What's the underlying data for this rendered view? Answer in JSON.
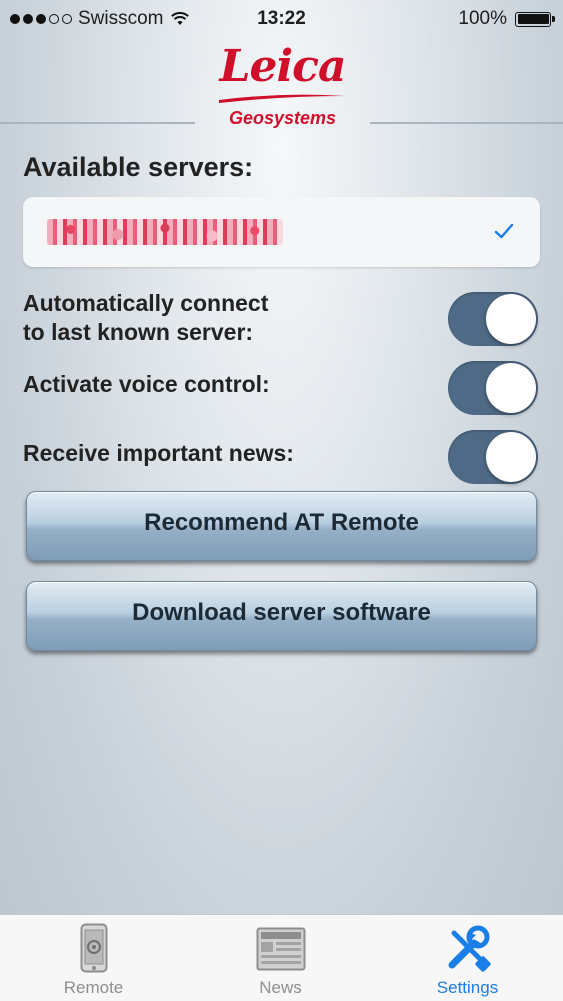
{
  "status_bar": {
    "carrier": "Swisscom",
    "time": "13:22",
    "battery": "100%"
  },
  "logo": {
    "brand": "Leica",
    "subtitle": "Geosystems"
  },
  "servers": {
    "heading": "Available servers:",
    "selected_server": "████████████",
    "selected": true
  },
  "settings": [
    {
      "label_line1": "Automatically connect",
      "label_line2": "to last known server:",
      "on": true
    },
    {
      "label": "Activate voice control:",
      "on": true
    },
    {
      "label": "Receive important news:",
      "on": true
    }
  ],
  "buttons": {
    "recommend": "Recommend AT Remote",
    "download": "Download server software"
  },
  "tabbar": {
    "tabs": [
      {
        "label": "Remote"
      },
      {
        "label": "News"
      },
      {
        "label": "Settings",
        "active": true
      }
    ]
  },
  "colors": {
    "accent": "#1a7de8",
    "brand": "#d0102b",
    "toggle_on": "#4f6a86"
  },
  "icons": {
    "wifi": "wifi-icon",
    "battery": "battery-icon",
    "check": "checkmark-icon",
    "remote": "phone-remote-icon",
    "news": "newspaper-icon",
    "settings": "wrench-screwdriver-icon"
  }
}
